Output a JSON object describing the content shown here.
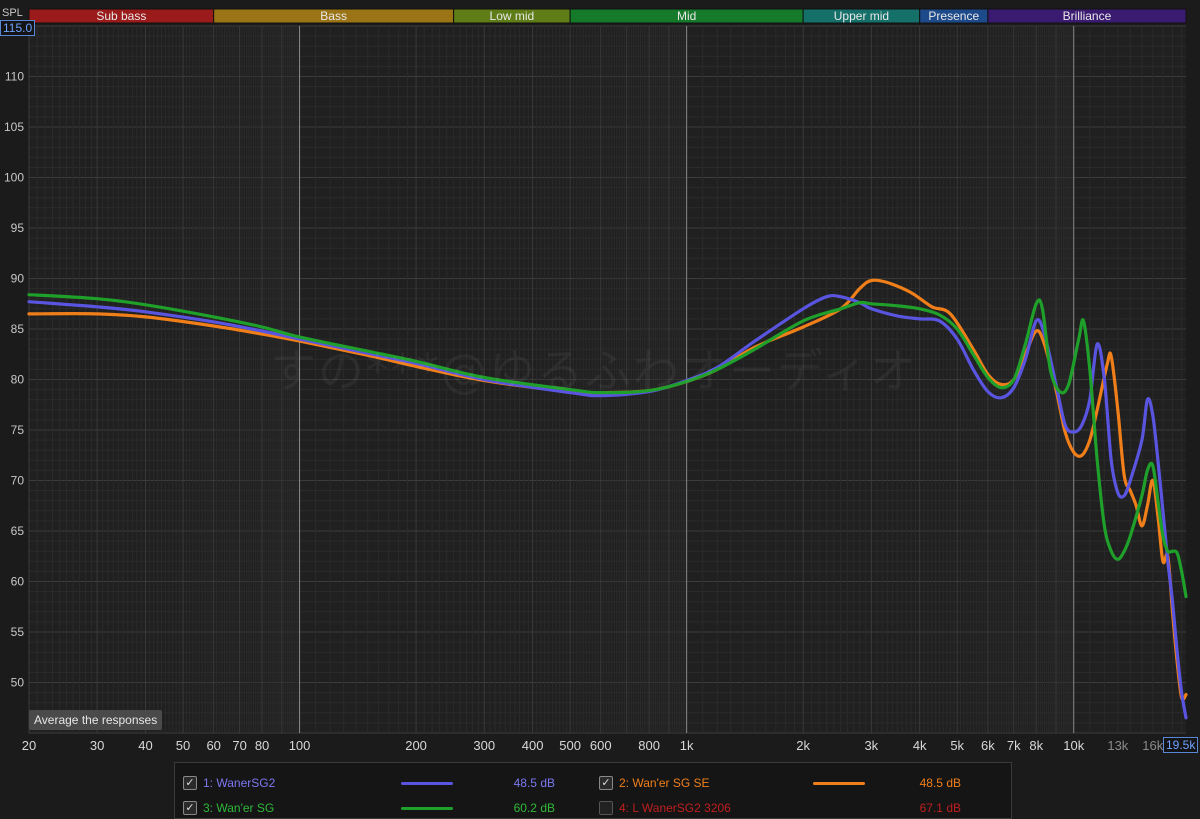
{
  "bands": [
    {
      "label": "Sub bass",
      "from": 20,
      "to": 60,
      "color": "#9b1a1a"
    },
    {
      "label": "Bass",
      "from": 60,
      "to": 250,
      "color": "#9a7415"
    },
    {
      "label": "Low mid",
      "from": 250,
      "to": 500,
      "color": "#5f7d16"
    },
    {
      "label": "Mid",
      "from": 500,
      "to": 2000,
      "color": "#157a2a"
    },
    {
      "label": "Upper mid",
      "from": 2000,
      "to": 4000,
      "color": "#15706a"
    },
    {
      "label": "Presence",
      "from": 4000,
      "to": 6000,
      "color": "#1d4a8a"
    },
    {
      "label": "Brilliance",
      "from": 6000,
      "to": 20000,
      "color": "#3b1b72"
    }
  ],
  "y_axis_title": "SPL",
  "y_top_readout": "115.0",
  "x_right_readout": "19.5k",
  "average_button": "Average the responses",
  "watermark_text": "すの***@ゆるふわオーディオ",
  "chart_data": {
    "type": "line",
    "x_scale": "log",
    "xlim": [
      20,
      19500
    ],
    "ylim": [
      45,
      115
    ],
    "grid": true,
    "y_ticks": [
      50,
      55,
      60,
      65,
      70,
      75,
      80,
      85,
      90,
      95,
      100,
      105,
      110
    ],
    "x_ticks": [
      {
        "v": 20,
        "label": "20"
      },
      {
        "v": 30,
        "label": "30"
      },
      {
        "v": 40,
        "label": "40"
      },
      {
        "v": 50,
        "label": "50"
      },
      {
        "v": 60,
        "label": "60"
      },
      {
        "v": 70,
        "label": "70"
      },
      {
        "v": 80,
        "label": "80"
      },
      {
        "v": 100,
        "label": "100"
      },
      {
        "v": 200,
        "label": "200"
      },
      {
        "v": 300,
        "label": "300"
      },
      {
        "v": 400,
        "label": "400"
      },
      {
        "v": 500,
        "label": "500"
      },
      {
        "v": 600,
        "label": "600"
      },
      {
        "v": 800,
        "label": "800"
      },
      {
        "v": 1000,
        "label": "1k"
      },
      {
        "v": 2000,
        "label": "2k"
      },
      {
        "v": 3000,
        "label": "3k"
      },
      {
        "v": 4000,
        "label": "4k"
      },
      {
        "v": 5000,
        "label": "5k"
      },
      {
        "v": 6000,
        "label": "6k"
      },
      {
        "v": 7000,
        "label": "7k"
      },
      {
        "v": 8000,
        "label": "8k"
      },
      {
        "v": 10000,
        "label": "10k"
      },
      {
        "v": 13000,
        "label": "13k"
      },
      {
        "v": 16000,
        "label": "16k"
      }
    ],
    "series": [
      {
        "name": "1: WanerSG2",
        "color": "#5a55e0",
        "checked": true,
        "level": "48.5 dB",
        "label_color": "#7b78f0",
        "points": [
          [
            20,
            87.7
          ],
          [
            30,
            87.2
          ],
          [
            40,
            86.7
          ],
          [
            60,
            85.7
          ],
          [
            80,
            84.8
          ],
          [
            100,
            84.0
          ],
          [
            150,
            82.6
          ],
          [
            200,
            81.6
          ],
          [
            300,
            80.0
          ],
          [
            500,
            78.7
          ],
          [
            600,
            78.4
          ],
          [
            800,
            78.8
          ],
          [
            1000,
            79.9
          ],
          [
            1200,
            81.2
          ],
          [
            1500,
            83.8
          ],
          [
            2000,
            87.0
          ],
          [
            2300,
            88.2
          ],
          [
            2500,
            88.2
          ],
          [
            2800,
            87.6
          ],
          [
            3000,
            87.0
          ],
          [
            3500,
            86.3
          ],
          [
            4000,
            86.0
          ],
          [
            4500,
            85.8
          ],
          [
            5000,
            84.0
          ],
          [
            5500,
            81.0
          ],
          [
            6000,
            78.8
          ],
          [
            6500,
            78.2
          ],
          [
            7000,
            79.2
          ],
          [
            7500,
            82.0
          ],
          [
            8000,
            85.8
          ],
          [
            8400,
            84.5
          ],
          [
            9000,
            79.5
          ],
          [
            9500,
            75.5
          ],
          [
            10000,
            74.8
          ],
          [
            10500,
            75.5
          ],
          [
            11000,
            78.0
          ],
          [
            11500,
            83.5
          ],
          [
            12000,
            80.0
          ],
          [
            12500,
            72.0
          ],
          [
            13000,
            68.8
          ],
          [
            13500,
            68.5
          ],
          [
            14000,
            70.0
          ],
          [
            15000,
            74.0
          ],
          [
            15500,
            78.0
          ],
          [
            16000,
            76.5
          ],
          [
            16500,
            72.0
          ],
          [
            17000,
            67.0
          ],
          [
            17500,
            62.0
          ],
          [
            18000,
            58.0
          ],
          [
            18500,
            53.0
          ],
          [
            19000,
            49.0
          ],
          [
            19500,
            46.5
          ]
        ]
      },
      {
        "name": "2: Wan'er SG SE",
        "color": "#f07f1a",
        "checked": true,
        "level": "48.5 dB",
        "label_color": "#f07f1a",
        "points": [
          [
            20,
            86.5
          ],
          [
            30,
            86.5
          ],
          [
            40,
            86.2
          ],
          [
            60,
            85.3
          ],
          [
            80,
            84.5
          ],
          [
            100,
            83.8
          ],
          [
            150,
            82.4
          ],
          [
            200,
            81.3
          ],
          [
            300,
            79.9
          ],
          [
            500,
            78.8
          ],
          [
            600,
            78.7
          ],
          [
            800,
            78.9
          ],
          [
            1000,
            79.8
          ],
          [
            1200,
            81.0
          ],
          [
            1500,
            83.2
          ],
          [
            2000,
            85.2
          ],
          [
            2500,
            87.0
          ],
          [
            2800,
            89.0
          ],
          [
            3000,
            89.8
          ],
          [
            3300,
            89.6
          ],
          [
            3800,
            88.6
          ],
          [
            4300,
            87.2
          ],
          [
            4800,
            86.5
          ],
          [
            5500,
            83.0
          ],
          [
            6000,
            80.5
          ],
          [
            6500,
            79.5
          ],
          [
            7000,
            80.0
          ],
          [
            7500,
            82.5
          ],
          [
            8000,
            84.8
          ],
          [
            8400,
            83.5
          ],
          [
            9000,
            79.0
          ],
          [
            9500,
            74.8
          ],
          [
            10000,
            72.8
          ],
          [
            10500,
            72.5
          ],
          [
            11000,
            74.0
          ],
          [
            11500,
            77.0
          ],
          [
            12200,
            81.5
          ],
          [
            12500,
            82.3
          ],
          [
            13000,
            77.0
          ],
          [
            13500,
            70.5
          ],
          [
            14000,
            69.0
          ],
          [
            14500,
            67.5
          ],
          [
            15000,
            65.5
          ],
          [
            15500,
            67.5
          ],
          [
            16000,
            70.0
          ],
          [
            16500,
            66.5
          ],
          [
            17000,
            62.0
          ],
          [
            17500,
            62.5
          ],
          [
            18000,
            57.0
          ],
          [
            18500,
            52.0
          ],
          [
            19000,
            48.5
          ],
          [
            19500,
            48.8
          ]
        ]
      },
      {
        "name": "3: Wan'er SG",
        "color": "#1fa02a",
        "checked": true,
        "level": "60.2 dB",
        "label_color": "#2fb83a",
        "points": [
          [
            20,
            88.4
          ],
          [
            30,
            88.0
          ],
          [
            40,
            87.4
          ],
          [
            60,
            86.2
          ],
          [
            80,
            85.2
          ],
          [
            100,
            84.2
          ],
          [
            150,
            82.8
          ],
          [
            200,
            81.8
          ],
          [
            300,
            80.2
          ],
          [
            500,
            79.0
          ],
          [
            600,
            78.7
          ],
          [
            800,
            78.9
          ],
          [
            1000,
            79.8
          ],
          [
            1200,
            81.0
          ],
          [
            1500,
            83.0
          ],
          [
            2000,
            85.8
          ],
          [
            2500,
            87.0
          ],
          [
            2800,
            87.6
          ],
          [
            3000,
            87.5
          ],
          [
            3500,
            87.3
          ],
          [
            4000,
            87.0
          ],
          [
            4500,
            86.4
          ],
          [
            5000,
            85.0
          ],
          [
            5500,
            82.5
          ],
          [
            6000,
            80.2
          ],
          [
            6500,
            79.2
          ],
          [
            7000,
            80.0
          ],
          [
            7500,
            83.5
          ],
          [
            8000,
            87.5
          ],
          [
            8300,
            87.0
          ],
          [
            8700,
            81.0
          ],
          [
            9200,
            78.8
          ],
          [
            9700,
            79.5
          ],
          [
            10300,
            84.0
          ],
          [
            10600,
            85.8
          ],
          [
            11000,
            81.0
          ],
          [
            11500,
            72.0
          ],
          [
            12000,
            65.5
          ],
          [
            12500,
            63.0
          ],
          [
            13000,
            62.2
          ],
          [
            13500,
            63.0
          ],
          [
            14000,
            64.5
          ],
          [
            15000,
            68.5
          ],
          [
            15500,
            71.0
          ],
          [
            16000,
            71.5
          ],
          [
            16500,
            68.0
          ],
          [
            17000,
            64.5
          ],
          [
            17500,
            63.0
          ],
          [
            18000,
            63.0
          ],
          [
            18500,
            62.8
          ],
          [
            19000,
            61.0
          ],
          [
            19500,
            58.5
          ]
        ]
      },
      {
        "name": "4: L WanerSG2 3206",
        "color": "#b01818",
        "checked": false,
        "level": "67.1 dB",
        "label_color": "#c01e1e",
        "points": []
      }
    ]
  }
}
